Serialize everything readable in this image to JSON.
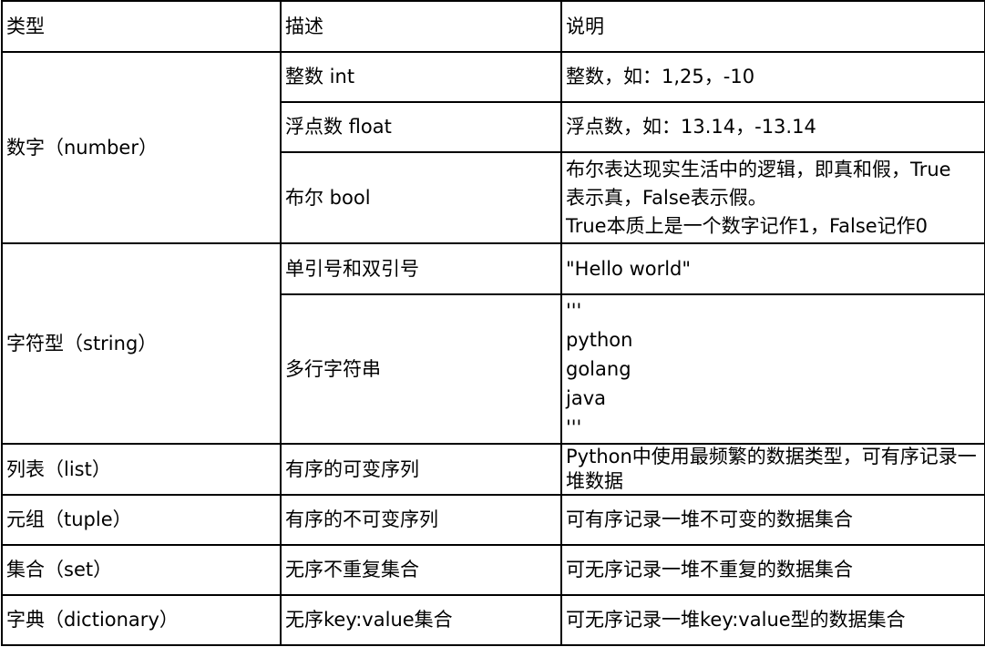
{
  "header": {
    "type": "类型",
    "desc": "描述",
    "note": "说明"
  },
  "rows": {
    "number": {
      "type": "数字（number）",
      "int": {
        "desc": "整数 int",
        "note": "整数，如：1,25，-10"
      },
      "float": {
        "desc": "浮点数 float",
        "note": "浮点数，如：13.14，-13.14"
      },
      "bool": {
        "desc": "布尔 bool",
        "note_lines": [
          "布尔表达现实生活中的逻辑，即真和假，True",
          "表示真，False表示假。",
          "True本质上是一个数字记作1，False记作0"
        ]
      }
    },
    "string": {
      "type": "字符型（string）",
      "quotes": {
        "desc": "单引号和双引号",
        "note": "\"Hello world\""
      },
      "multiline": {
        "desc": "多行字符串",
        "note_lines": [
          "'''",
          "python",
          "golang",
          "java",
          "'''"
        ]
      }
    },
    "list": {
      "type": "列表（list）",
      "desc": "有序的可变序列",
      "note": "Python中使用最频繁的数据类型，可有序记录一堆数据"
    },
    "tuple": {
      "type": "元组（tuple）",
      "desc": "有序的不可变序列",
      "note": "可有序记录一堆不可变的数据集合"
    },
    "set": {
      "type": "集合（set）",
      "desc": "无序不重复集合",
      "note": "可无序记录一堆不重复的数据集合"
    },
    "dict": {
      "type": "字典（dictionary）",
      "desc": "无序key:value集合",
      "note": "可无序记录一堆key:value型的数据集合"
    }
  }
}
